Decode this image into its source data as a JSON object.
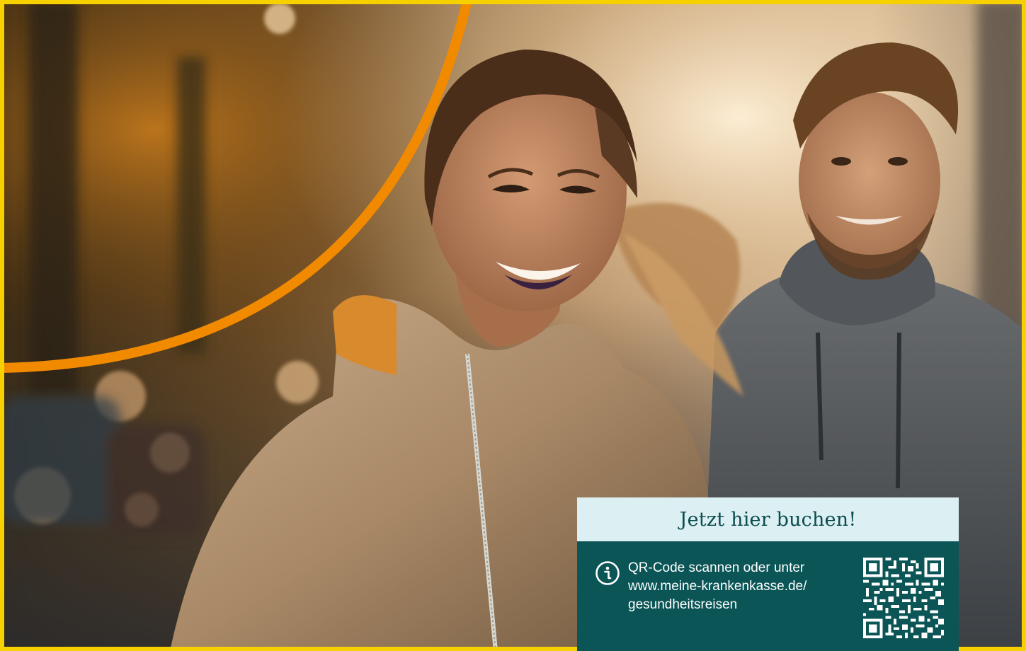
{
  "image": {
    "description_icon": "photo-running-couple",
    "accent_color": "#f28a00",
    "frame_color": "#f7d000"
  },
  "booking": {
    "title": "Jetzt hier buchen!",
    "line1": "QR-Code scannen oder unter",
    "line2": "www.meine-krankenkasse.de/",
    "line3": "gesundheitsreisen",
    "icon": "info-icon",
    "qr_icon": "qr-code-icon",
    "header_color": "#dceff2",
    "body_color": "#0b5556"
  }
}
